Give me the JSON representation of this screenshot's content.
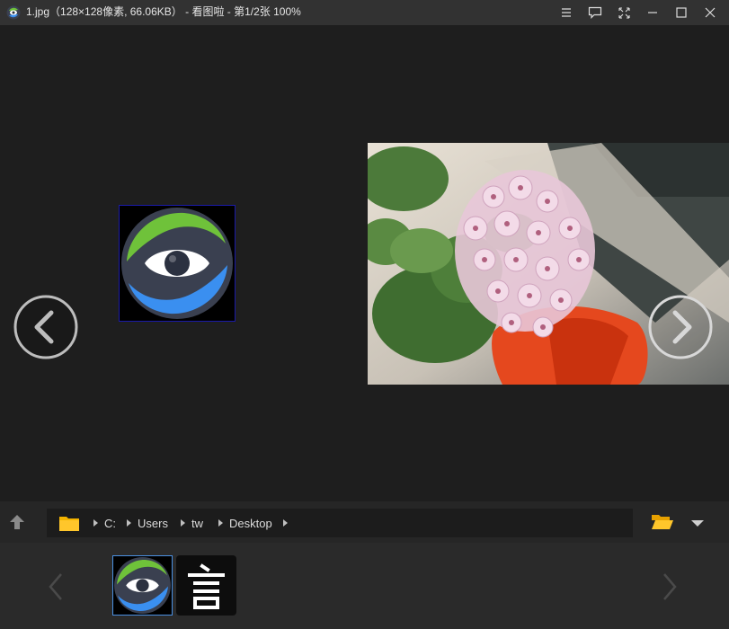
{
  "titlebar": {
    "title": "1.jpg（128×128像素, 66.06KB） - 看图啦 - 第1/2张 100%",
    "buttons": [
      "menu-icon",
      "chat-icon",
      "fullscreen-icon",
      "minimize-icon",
      "maximize-icon",
      "close-icon"
    ]
  },
  "path": {
    "crumbs": [
      "C:",
      "Users",
      "tw",
      "Desktop"
    ]
  },
  "colors": {
    "background": "#1e1e1e",
    "titlebar": "#323232",
    "filmstrip": "#2a2a2a",
    "selection": "#4a90e2",
    "folder": "#f4b400",
    "logo_green": "#6fc23a",
    "logo_blue": "#3a8ff0"
  },
  "filmstrip": {
    "items": [
      "logo-thumbnail",
      "text-glyph-thumbnail"
    ],
    "selected_index": 0
  }
}
